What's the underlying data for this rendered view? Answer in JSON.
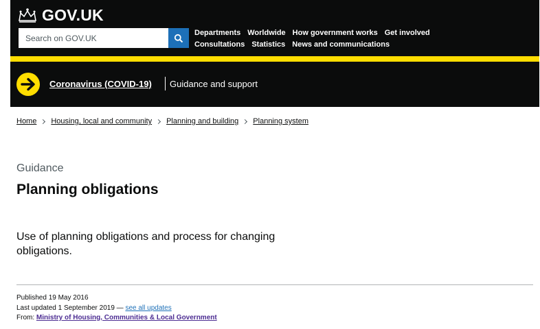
{
  "header": {
    "logo_text": "GOV.UK",
    "search_placeholder": "Search on GOV.UK",
    "nav_row1": [
      "Departments",
      "Worldwide",
      "How government works",
      "Get involved"
    ],
    "nav_row2": [
      "Consultations",
      "Statistics",
      "News and communications"
    ]
  },
  "covid_banner": {
    "link": "Coronavirus (COVID-19)",
    "text": "Guidance and support"
  },
  "breadcrumb": [
    "Home",
    "Housing, local and community",
    "Planning and building",
    "Planning system"
  ],
  "page": {
    "caption": "Guidance",
    "title": "Planning obligations",
    "lead": "Use of planning obligations and process for changing obligations."
  },
  "metadata": {
    "published": "Published 19 May 2016",
    "updated": "Last updated 1 September 2019 —",
    "updates_link": "see all updates",
    "from_label": "From:",
    "organisation": "Ministry of Housing, Communities & Local Government"
  },
  "colors": {
    "header_bg": "#0b0c0c",
    "yellow": "#ffdd00",
    "link_blue": "#1d70b8",
    "link_purple": "#4c2c92"
  }
}
